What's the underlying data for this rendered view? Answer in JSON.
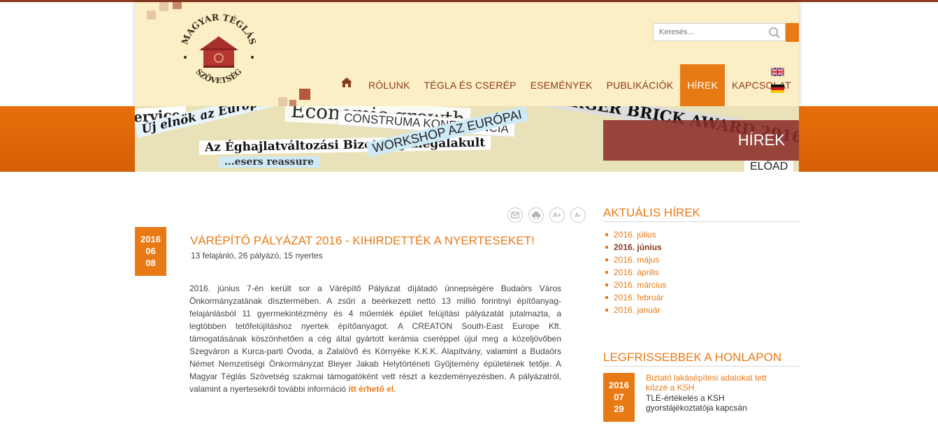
{
  "search": {
    "placeholder": "Keresés..."
  },
  "logo": {
    "text_top": "MAGYAR TÉGLÁS",
    "text_bottom": "SZÖVETSÉG"
  },
  "nav": {
    "items": [
      {
        "label": "RÓLUNK"
      },
      {
        "label": "TÉGLA ÉS CSERÉP"
      },
      {
        "label": "ESEMÉNYEK"
      },
      {
        "label": "PUBLIKÁCIÓK"
      },
      {
        "label": "HÍREK",
        "active": true
      },
      {
        "label": "KAPCSOLAT"
      }
    ],
    "home_icon": "home-icon"
  },
  "languages": [
    "english-flag-icon",
    "german-flag-icon"
  ],
  "banner": {
    "label": "HÍREK",
    "clippings": [
      "Új elnök az Európai Téglás",
      "Economic growth",
      "CONSTRUMA KONFERENCIA",
      "BERGER BRICK AWARD 2016",
      "Az Éghajlatváltozási Bizottság megalakult",
      "WORKSHOP AZ EURÓPAI",
      "...esers reassure",
      "ELŐAD"
    ]
  },
  "article": {
    "date": {
      "year": "2016",
      "month": "06",
      "day": "08"
    },
    "title": "VÁRÉPÍTŐ PÁLYÁZAT 2016 - KIHIRDETTÉK A NYERTESEKET!",
    "subtitle": "13 felajánló, 26 pályázó, 15 nyertes",
    "body": "2016. június 7-én került sor a Várépítő Pályázat díjátadó ünnepségére Budaörs Város Önkormányzatának dísztermében. A zsűri a beérkezett nettó 13 millió forintnyi építőanyag-felajánlásból 11 gyermekintézmény és 4 műemlék épület felújítási pályázatát jutalmazta, a legtöbben tetőfelújításhoz nyertek építőanyagot. A CREATON South-East Europe Kft. támogatásának köszönhetően a cég által gyártott kerámia cseréppel újul meg a közeljövőben Szegváron a Kurca-parti Óvoda, a Zalalövő és Környéke K.K.K. Alapítvány, valamint a Budaörs Német Nemzetiségi Önkormányzat Bleyer Jakab Helytörténeti Gyűjtemény épületének tetője. A Magyar Téglás Szövetség szakmai támogatóként vett részt a kezdeményezésben. A pályázatról, valamint a nyertesekről további információ ",
    "link": "itt érhető el",
    "body_end": ".",
    "tools": [
      {
        "icon": "email-icon"
      },
      {
        "icon": "print-icon"
      },
      {
        "icon": "font-increase-icon",
        "label": "A+"
      },
      {
        "icon": "font-decrease-icon",
        "label": "A-"
      }
    ]
  },
  "sidebar": {
    "current_news_title": "AKTUÁLIS HÍREK",
    "months": [
      {
        "label": "2016. július"
      },
      {
        "label": "2016. június",
        "active": true
      },
      {
        "label": "2016. május"
      },
      {
        "label": "2016. április"
      },
      {
        "label": "2016. március"
      },
      {
        "label": "2016. február"
      },
      {
        "label": "2016. január"
      }
    ],
    "latest_title": "LEGFRISSEBBEK A HONLAPON",
    "latest": {
      "date": {
        "year": "2016",
        "month": "07",
        "day": "29"
      },
      "title": "Biztató lakásépítési adatokat tett közzé a KSH",
      "subtitle": "TLE-értékelés a KSH gyorstájékoztatója kapcsán"
    }
  },
  "colors": {
    "accent": "#e87a16",
    "brown": "#8a3a1f",
    "header_bg": "#fcefc6"
  }
}
